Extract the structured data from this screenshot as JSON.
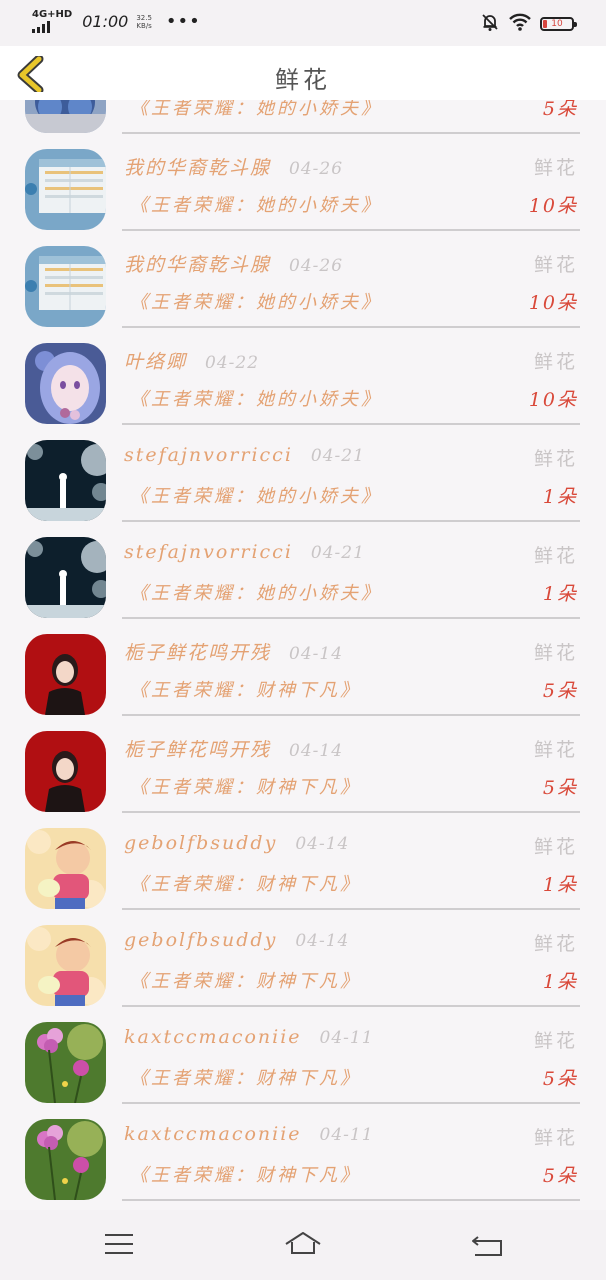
{
  "status_bar": {
    "network": "4G+HD",
    "time": "01:00",
    "speed_value": "32.5",
    "speed_unit": "KB/s",
    "more": "•••",
    "battery": "10",
    "icons": [
      "mute-bell-icon",
      "wifi-icon",
      "battery-icon"
    ]
  },
  "header": {
    "title": "鲜花",
    "back_icon": "chevron-left-icon",
    "accent_color": "#e8c62a"
  },
  "records": [
    {
      "user": "",
      "date": "",
      "type": "",
      "book": "《王者荣耀：她的小娇夫》",
      "amount": "5朵",
      "avatar": "avatar-crown"
    },
    {
      "user": "我的华裔乾斗腺",
      "date": "04-26",
      "type": "鲜花",
      "book": "《王者荣耀：她的小娇夫》",
      "amount": "10朵",
      "avatar": "avatar-screenshot"
    },
    {
      "user": "我的华裔乾斗腺",
      "date": "04-26",
      "type": "鲜花",
      "book": "《王者荣耀：她的小娇夫》",
      "amount": "10朵",
      "avatar": "avatar-screenshot"
    },
    {
      "user": "叶络卿",
      "date": "04-22",
      "type": "鲜花",
      "book": "《王者荣耀：她的小娇夫》",
      "amount": "10朵",
      "avatar": "avatar-anime-girl"
    },
    {
      "user": "stefajnvorricci",
      "date": "04-21",
      "type": "鲜花",
      "book": "《王者荣耀：她的小娇夫》",
      "amount": "1朵",
      "avatar": "avatar-night-tree"
    },
    {
      "user": "stefajnvorricci",
      "date": "04-21",
      "type": "鲜花",
      "book": "《王者荣耀：她的小娇夫》",
      "amount": "1朵",
      "avatar": "avatar-night-tree"
    },
    {
      "user": "栀子鲜花鸣开残",
      "date": "04-14",
      "type": "鲜花",
      "book": "《王者荣耀：财神下凡》",
      "amount": "5朵",
      "avatar": "avatar-red-girl"
    },
    {
      "user": "栀子鲜花鸣开残",
      "date": "04-14",
      "type": "鲜花",
      "book": "《王者荣耀：财神下凡》",
      "amount": "5朵",
      "avatar": "avatar-red-girl"
    },
    {
      "user": "gebolfbsuddy",
      "date": "04-14",
      "type": "鲜花",
      "book": "《王者荣耀：财神下凡》",
      "amount": "1朵",
      "avatar": "avatar-cartoon-boy"
    },
    {
      "user": "gebolfbsuddy",
      "date": "04-14",
      "type": "鲜花",
      "book": "《王者荣耀：财神下凡》",
      "amount": "1朵",
      "avatar": "avatar-cartoon-boy"
    },
    {
      "user": "kaxtccmaconiie",
      "date": "04-11",
      "type": "鲜花",
      "book": "《王者荣耀：财神下凡》",
      "amount": "5朵",
      "avatar": "avatar-flower"
    },
    {
      "user": "kaxtccmaconiie",
      "date": "04-11",
      "type": "鲜花",
      "book": "《王者荣耀：财神下凡》",
      "amount": "5朵",
      "avatar": "avatar-flower"
    }
  ],
  "nav_bar": {
    "icons": [
      "menu-icon",
      "home-icon",
      "back-icon"
    ]
  }
}
